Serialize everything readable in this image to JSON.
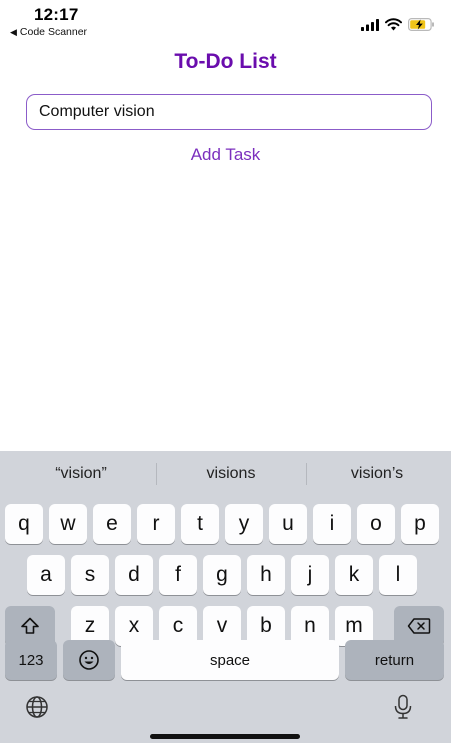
{
  "status_bar": {
    "time": "12:17",
    "back_app": "Code Scanner",
    "icons": [
      "signal-icon",
      "wifi-icon",
      "battery-charging-icon"
    ]
  },
  "app": {
    "title": "To-Do List",
    "task_input": {
      "value": "Computer vision",
      "placeholder": ""
    },
    "add_task_label": "Add Task"
  },
  "keyboard": {
    "suggestions": [
      "“vision”",
      "visions",
      "vision’s"
    ],
    "row1": [
      "q",
      "w",
      "e",
      "r",
      "t",
      "y",
      "u",
      "i",
      "o",
      "p"
    ],
    "row2": [
      "a",
      "s",
      "d",
      "f",
      "g",
      "h",
      "j",
      "k",
      "l"
    ],
    "row3": [
      "z",
      "x",
      "c",
      "v",
      "b",
      "n",
      "m"
    ],
    "numbers_label": "123",
    "space_label": "space",
    "return_label": "return"
  },
  "colors": {
    "accent": "#6a0dad",
    "input_border": "#8b5cc9",
    "keyboard_bg": "#d1d4da",
    "battery": "#f0c419"
  }
}
